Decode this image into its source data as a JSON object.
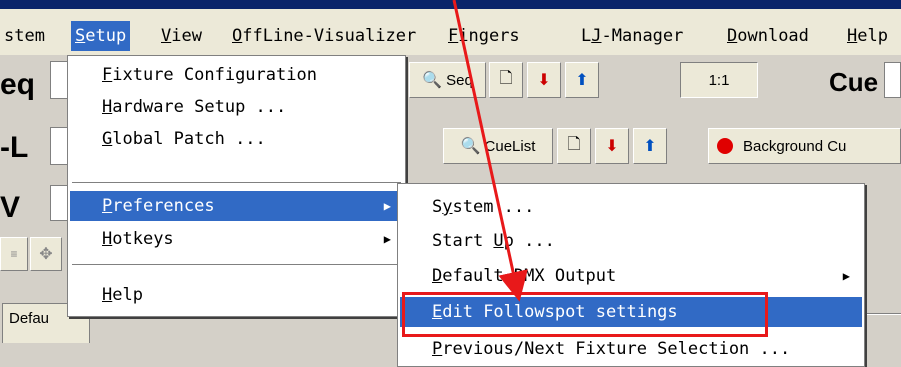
{
  "menubar": {
    "items": [
      {
        "label": "stem"
      },
      {
        "prefix": "",
        "u": "S",
        "rest": "etup"
      },
      {
        "prefix": "",
        "u": "V",
        "rest": "iew"
      },
      {
        "prefix": "",
        "u": "O",
        "rest": "ffLine-Visualizer"
      },
      {
        "prefix": "",
        "u": "F",
        "rest": "ingers"
      },
      {
        "prefix": "L",
        "u": "J",
        "rest": "-Manager"
      },
      {
        "prefix": "",
        "u": "D",
        "rest": "ownload"
      },
      {
        "prefix": "",
        "u": "H",
        "rest": "elp"
      }
    ]
  },
  "app": {
    "row1_label": "eq",
    "row2_label": "-L",
    "row3_label": "V",
    "seq_button": "Seq",
    "cuelist_button": "CueList",
    "counter": "1:1",
    "cue_label": "Cue",
    "background_cue": "Background Cu",
    "default_tab": "Defau"
  },
  "setup_menu": {
    "items": [
      {
        "u": "F",
        "rest": "ixture Configuration"
      },
      {
        "u": "H",
        "rest": "ardware Setup ..."
      },
      {
        "u": "G",
        "rest": "lobal Patch ..."
      },
      {
        "u": "P",
        "rest": "references"
      },
      {
        "u": "H",
        "rest": "otkeys"
      },
      {
        "u": "H",
        "rest": "elp"
      }
    ]
  },
  "preferences_menu": {
    "items": [
      {
        "pre": "S",
        "u": "y",
        "rest": "stem ..."
      },
      {
        "pre": "Start ",
        "u": "U",
        "rest": "p ..."
      },
      {
        "pre": "",
        "u": "D",
        "rest": "efault DMX Output"
      },
      {
        "pre": "",
        "u": "E",
        "rest": "dit Followspot settings"
      },
      {
        "pre": "",
        "u": "P",
        "rest": "revious/Next Fixture Selection ..."
      }
    ]
  },
  "colors": {
    "highlight": "#316ac5",
    "annotation": "#e8191a"
  }
}
